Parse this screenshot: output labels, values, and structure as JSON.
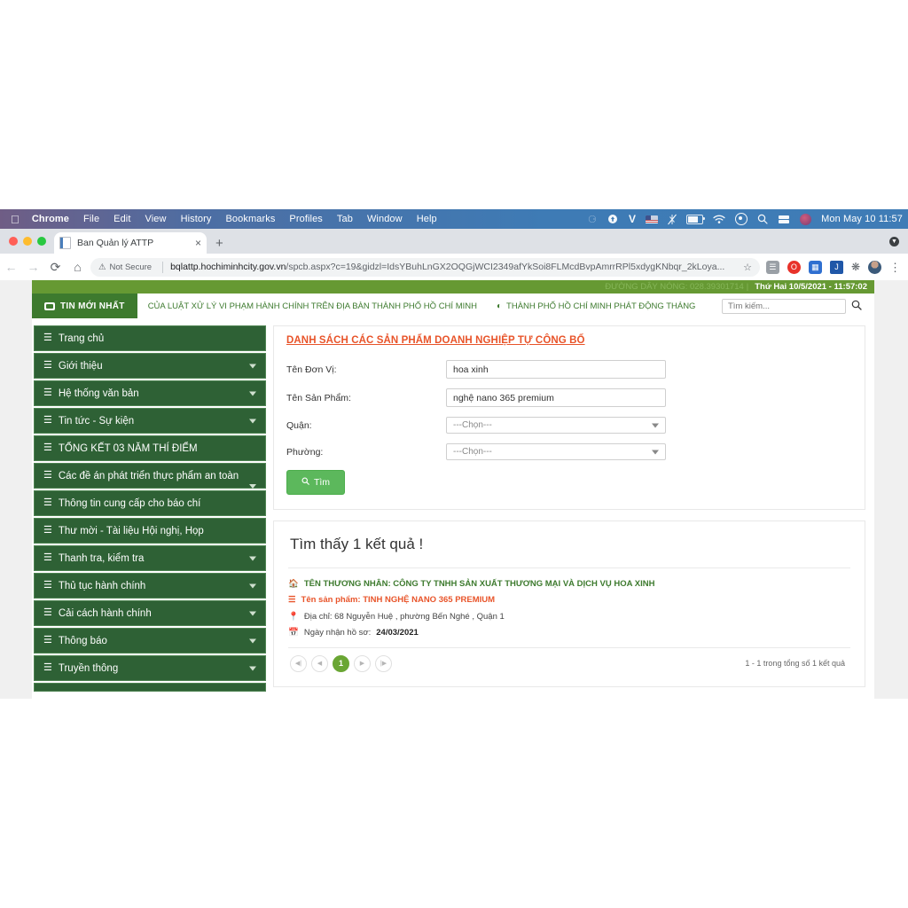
{
  "os_menubar": {
    "apple_icon": "apple-icon",
    "items": [
      {
        "label": "Chrome",
        "bold": true
      },
      {
        "label": "File",
        "bold": false
      },
      {
        "label": "Edit",
        "bold": false
      },
      {
        "label": "View",
        "bold": false
      },
      {
        "label": "History",
        "bold": false
      },
      {
        "label": "Bookmarks",
        "bold": false
      },
      {
        "label": "Profiles",
        "bold": false
      },
      {
        "label": "Tab",
        "bold": false
      },
      {
        "label": "Window",
        "bold": false
      },
      {
        "label": "Help",
        "bold": false
      }
    ],
    "status_icons": [
      "dots-circle-icon",
      "cloud-upload-icon",
      "letter-v-icon",
      "us-flag-icon",
      "bluetooth-off-icon",
      "battery-charging-icon",
      "wifi-icon",
      "control-center-icon",
      "spotlight-search-icon",
      "screen-sharing-icon",
      "user-avatar-icon"
    ],
    "letter_v": "V",
    "clock": "Mon May 10  11:57"
  },
  "browser": {
    "tab": {
      "title": "Ban Quản lý ATTP",
      "close_label": "×",
      "favicon": "document-favicon"
    },
    "new_tab_label": "+",
    "nav": {
      "back": "←",
      "forward": "→",
      "reload": "⟳",
      "home": "⌂"
    },
    "omnibox": {
      "security_label": "Not Secure",
      "security_icon": "warning-triangle-icon",
      "url_host": "bqlattp.hochiminhcity.gov.vn",
      "url_path": "/spcb.aspx?c=19&gidzl=IdsYBuhLnGX2OQGjWCI2349afYkSoi8FLMcdBvpAmrrRPl5xdygKNbqr_2kLoya...",
      "star_icon": "bookmark-star-icon"
    },
    "extensions": [
      "puzzle-grey-icon",
      "opera-red-icon",
      "blue-badge-icon",
      "blue-bookmark-icon",
      "puzzle-icon"
    ],
    "profile_icon": "profile-avatar",
    "menu_icon": "kebab-menu-icon"
  },
  "site": {
    "hotline": {
      "label": "ĐƯỜNG DÂY NÓNG: 028.39301714",
      "separator": "|",
      "datetime": "Thứ Hai 10/5/2021 - 11:57:02"
    },
    "ticker": {
      "badge": "TIN MỚI NHẤT",
      "badge_icon": "tv-icon",
      "items": [
        "CỦA LUẬT XỬ LÝ VI PHẠM HÀNH CHÍNH TRÊN ĐỊA BÀN THÀNH PHỐ HỒ CHÍ MINH",
        "THÀNH PHỐ HỒ CHÍ MINH PHÁT ĐỘNG THÁNG"
      ],
      "search_placeholder": "Tìm kiếm...",
      "search_value": "",
      "search_icon": "search-icon"
    },
    "sidebar": {
      "items": [
        {
          "label": "Trang chủ",
          "caret": false
        },
        {
          "label": "Giới thiệu",
          "caret": true
        },
        {
          "label": "Hệ thống văn bản",
          "caret": true
        },
        {
          "label": "Tin tức - Sự kiện",
          "caret": true
        },
        {
          "label": "TỔNG KẾT 03 NĂM THÍ ĐIỂM",
          "caret": false
        },
        {
          "label": "Các đề án phát triển thực phẩm an toàn",
          "caret": true
        },
        {
          "label": "Thông tin cung cấp cho báo chí",
          "caret": false
        },
        {
          "label": "Thư mời - Tài liệu Hội nghị, Họp",
          "caret": false
        },
        {
          "label": "Thanh tra, kiểm tra",
          "caret": true
        },
        {
          "label": "Thủ tục hành chính",
          "caret": true
        },
        {
          "label": "Cải cách hành chính",
          "caret": true
        },
        {
          "label": "Thông báo",
          "caret": true
        },
        {
          "label": "Truyền thông",
          "caret": true
        }
      ]
    },
    "search_form": {
      "title": "DANH SÁCH CÁC SẢN PHẨM DOANH NGHIỆP TỰ CÔNG BỐ",
      "fields": [
        {
          "label": "Tên Đơn Vị:",
          "value": "hoa xinh"
        },
        {
          "label": "Tên Sản Phẩm:",
          "value": "nghệ nano 365 premium"
        }
      ],
      "selects": [
        {
          "label": "Quận:",
          "value": "---Chọn---"
        },
        {
          "label": "Phường:",
          "value": "---Chọn---"
        }
      ],
      "submit_label": "Tìm",
      "submit_icon": "search-icon"
    },
    "results": {
      "heading": "Tìm thấy 1 kết quả !",
      "items": [
        {
          "merchant": "TÊN THƯƠNG NHÂN: CÔNG TY TNHH SẢN XUẤT THƯƠNG MẠI VÀ DỊCH VỤ HOA XINH",
          "merchant_icon": "home-icon",
          "product": "Tên sản phẩm: TINH NGHỆ NANO 365 PREMIUM",
          "product_icon": "list-icon",
          "address": "Địa chỉ: 68 Nguyễn Huệ , phường Bến Nghé , Quận 1",
          "address_icon": "map-pin-icon",
          "date_label": "Ngày nhận hồ sơ:",
          "date_value": "24/03/2021",
          "date_icon": "calendar-icon"
        }
      ],
      "pagination": {
        "first": "◀|",
        "prev": "◀",
        "current": "1",
        "next": "▶",
        "last": "|▶",
        "info": "1 - 1 trong tổng số 1 kết quả"
      }
    }
  },
  "colors": {
    "brand_green": "#2e6135",
    "hotline_green": "#669933",
    "accent_orange": "#e8542a",
    "ticker_green": "#3d7a2e",
    "button_green": "#5cb85c",
    "page_active": "#6aa634"
  }
}
